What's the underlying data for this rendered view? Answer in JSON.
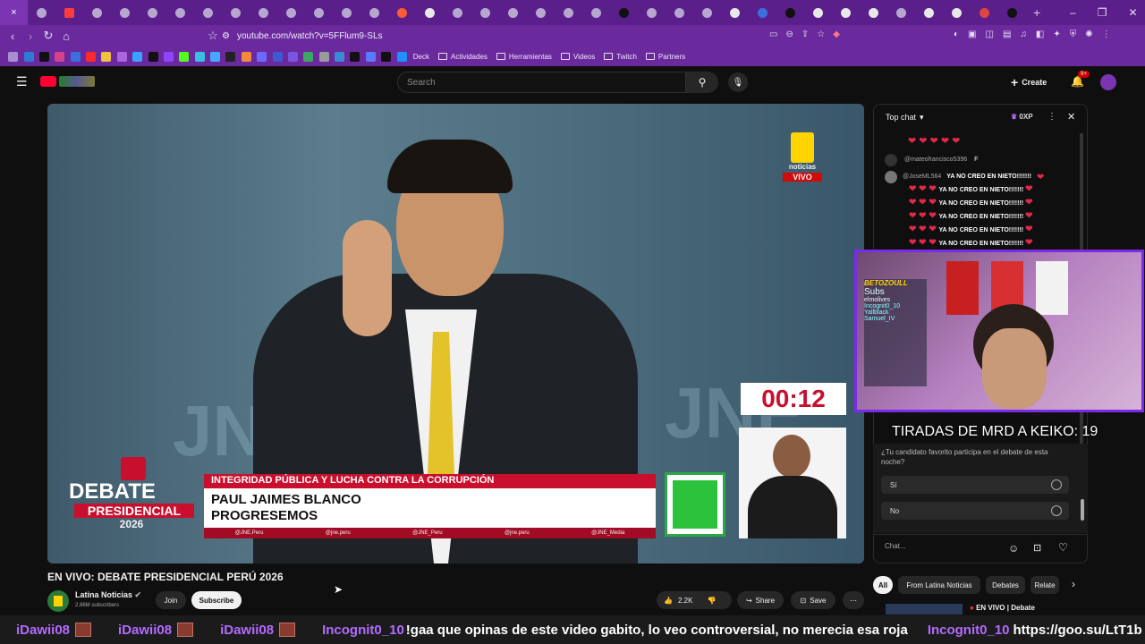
{
  "browser": {
    "url": "youtube.com/watch?v=5FFlum9-SLs",
    "close_tab": "×",
    "new_tab": "+"
  },
  "bookmarks": {
    "folders": [
      "Deck",
      "Actividades",
      "Herramientas",
      "Videos",
      "Twitch",
      "Partners"
    ]
  },
  "youtube": {
    "search_placeholder": "Search",
    "create_label": "Create",
    "notif_badge": "9+"
  },
  "video": {
    "badge_brand": "noticias",
    "badge_live": "VIVO",
    "timer": "00:12",
    "topic": "INTEGRIDAD PÚBLICA Y LUCHA CONTRA LA CORRUPCIÓN",
    "name_line1": "PAUL JAIMES BLANCO",
    "name_line2": "PROGRESEMOS",
    "logo_debate": "DEBATE",
    "logo_pres": "PRESIDENCIAL",
    "logo_year": "2026",
    "logo_jne": "JNE",
    "socials": [
      "@JNE.Peru",
      "@jne.peru",
      "@JNE_Peru",
      "@jne.peru",
      "@JNE_Media"
    ]
  },
  "chat": {
    "header": "Top chat",
    "points": "0XP",
    "msgs": [
      {
        "user": "@mateofrancisco5396",
        "text": "F"
      },
      {
        "user": "@JoseML564",
        "text": "YA NO CREO EN NIETO!!!!!!!"
      }
    ],
    "repeat_text": "YA NO CREO EN NIETO!!!!!!!",
    "poll_question": "¿Tu candidato favorito participa en el debate de esta noche?",
    "poll_options": [
      "Sí",
      "No"
    ],
    "input_placeholder": "Chat..."
  },
  "overlay": {
    "counter": "TIRADAS DE MRD A KEIKO: 19",
    "board_title": "BETOZOULL",
    "board_sub": "Subs",
    "board_names": [
      "elmolives",
      "Incognit0_10",
      "Yallblack",
      "Samuel_IV"
    ]
  },
  "below": {
    "title": "EN VIVO: DEBATE PRESIDENCIAL PERÚ 2026",
    "channel": "Latina Noticias",
    "subs": "2.86M subscribers",
    "join": "Join",
    "subscribe": "Subscribe",
    "likes": "2.2K",
    "share": "Share",
    "save": "Save",
    "chips": [
      "All",
      "From Latina Noticias",
      "Debates",
      "Relate"
    ],
    "rec_title": "EN VIVO | Debate"
  },
  "ticker": {
    "names": [
      "iDawii08",
      "iDawii08",
      "iDawii08"
    ],
    "msg1_user": "Incognit0_10",
    "msg1_text": "!gaa que opinas de este video gabito, lo veo controversial, no merecia esa roja",
    "msg2_user": "Incognit0_10",
    "msg2_text": "https://goo.su/LtT1b"
  }
}
